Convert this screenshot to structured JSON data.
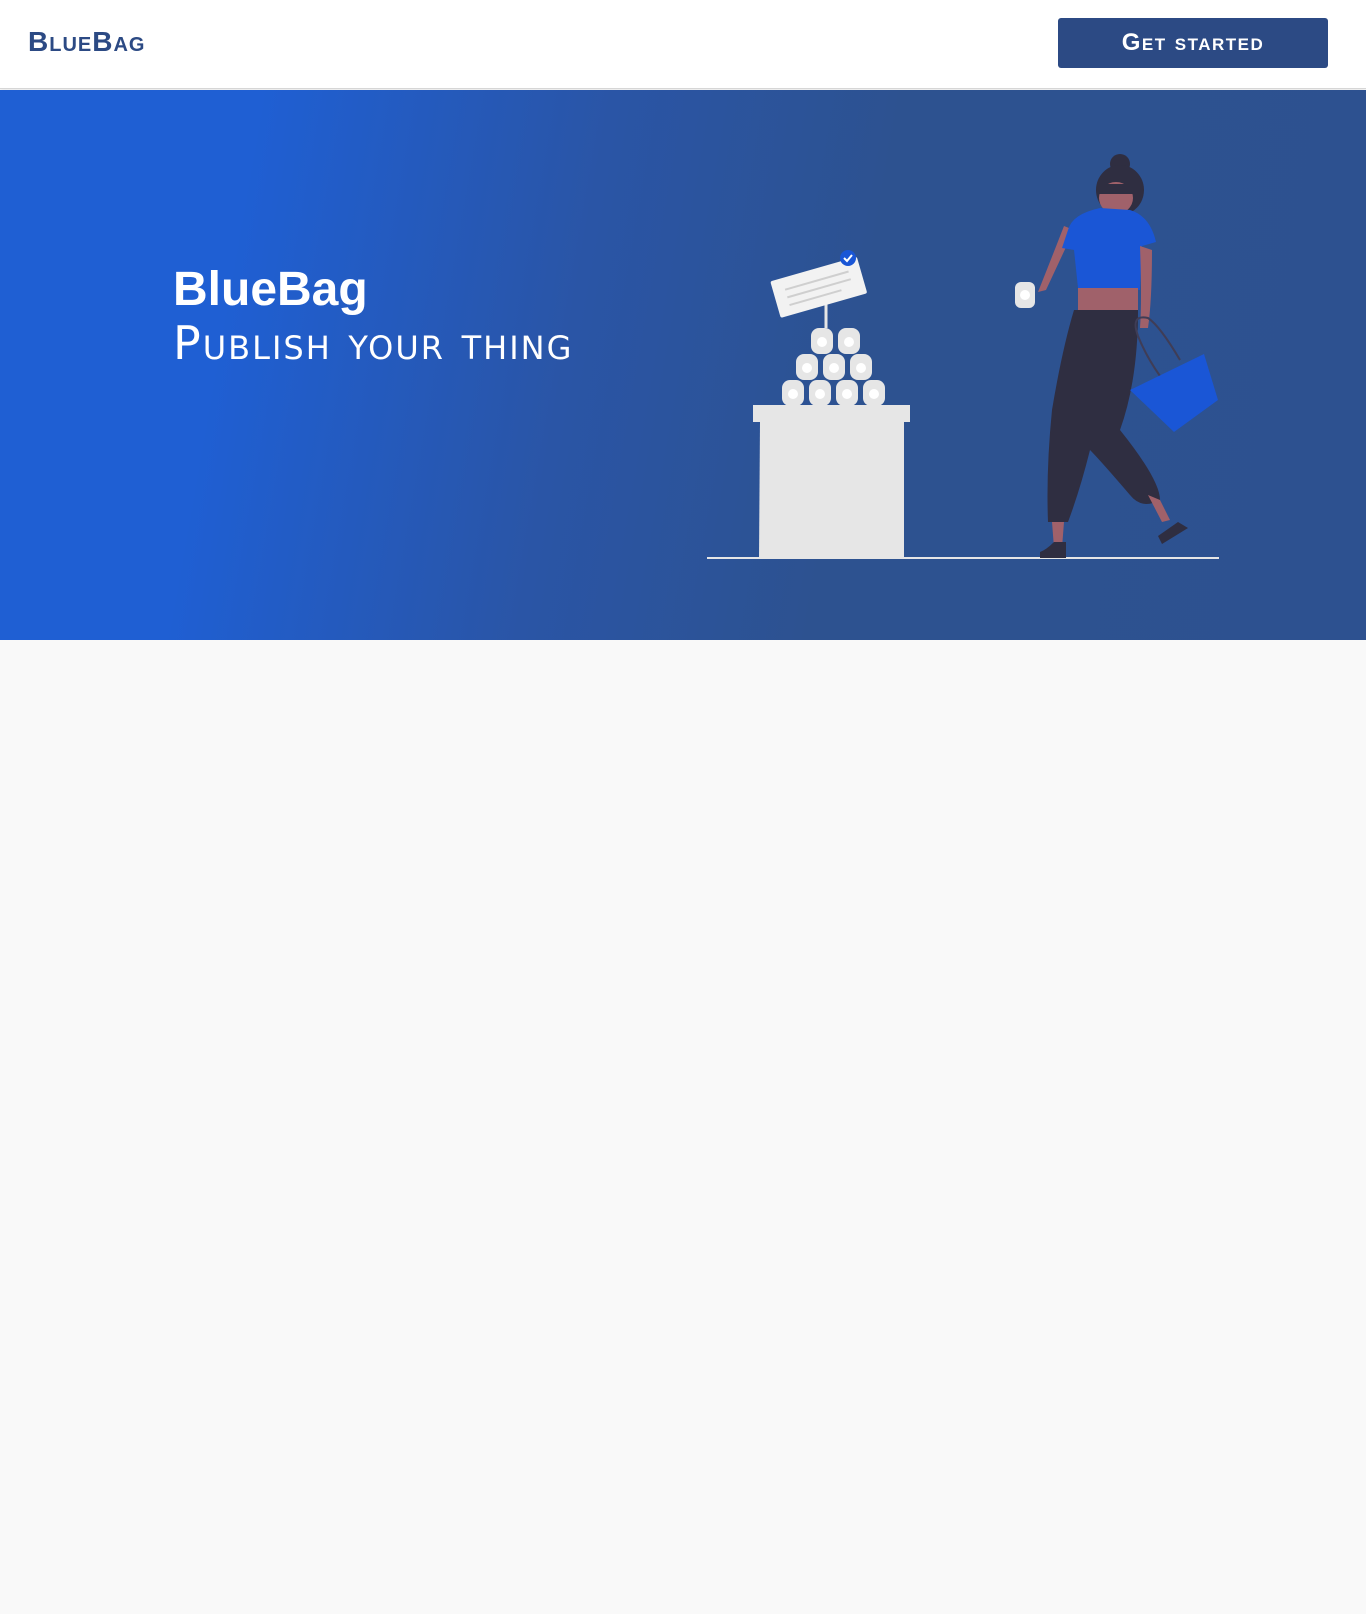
{
  "navbar": {
    "brand": "BlueBag",
    "cta_label": "Get started"
  },
  "hero": {
    "title": "BlueBag",
    "subtitle": "Publish your thing"
  },
  "colors": {
    "brand": "#2c4a84",
    "hero_left": "#1f5fd3",
    "hero_right": "#2d5190",
    "accent": "#1a56d6",
    "background": "#f9f9f9"
  }
}
